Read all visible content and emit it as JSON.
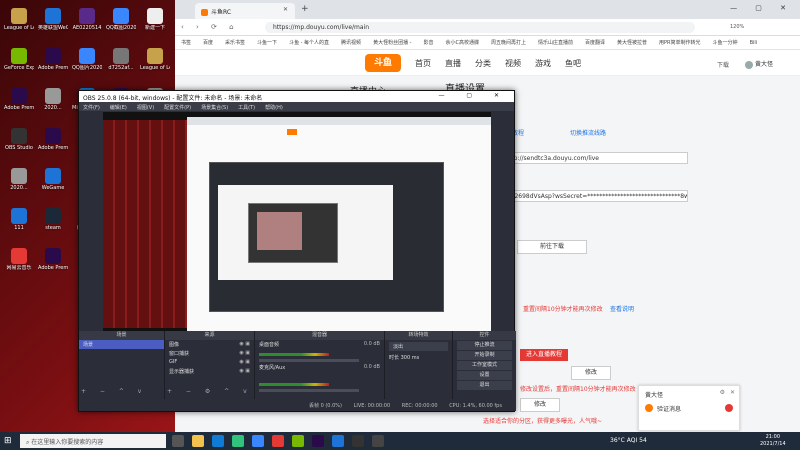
{
  "desktop": {
    "icons": [
      {
        "label": "League of Legends",
        "color": "#c8a24a"
      },
      {
        "label": "英雄联盟WeGame版",
        "color": "#1e73d6"
      },
      {
        "label": "AE0220514",
        "color": "#5a2a8a"
      },
      {
        "label": "QQ截图2020...",
        "color": "#3a86ff"
      },
      {
        "label": "新建一下",
        "color": "#eeeeee"
      },
      {
        "label": "GeForce Experience",
        "color": "#76b900"
      },
      {
        "label": "Adobe Premie...",
        "color": "#2a0a4a"
      },
      {
        "label": "QQ图片2020...",
        "color": "#3a86ff"
      },
      {
        "label": "d7252af...",
        "color": "#777777"
      },
      {
        "label": "League of Legends",
        "color": "#c8a24a"
      },
      {
        "label": "Adobe Premie...",
        "color": "#2a0a4a"
      },
      {
        "label": "2020...",
        "color": "#999999"
      },
      {
        "label": "Microsoft Edge",
        "color": "#0f7bd6"
      },
      {
        "label": "Adobe Premie...",
        "color": "#2a0a4a"
      },
      {
        "label": "2020...",
        "color": "#999999"
      },
      {
        "label": "OBS Studio",
        "color": "#333333"
      },
      {
        "label": "Adobe Premie...",
        "color": "#2a0a4a"
      },
      {
        "label": "2021...",
        "color": "#999999"
      },
      {
        "label": "QQ音乐",
        "color": "#31c27c"
      },
      {
        "label": "logs",
        "color": "#f2c14e"
      },
      {
        "label": "2020...",
        "color": "#999999"
      },
      {
        "label": "WeGame",
        "color": "#1e73d6"
      },
      {
        "label": "视频",
        "color": "#f2c14e"
      },
      {
        "label": "腾讯QQ",
        "color": "#3a86ff"
      },
      {
        "label": "韦行TURE",
        "color": "#f2c14e"
      },
      {
        "label": "111",
        "color": "#1e73d6"
      },
      {
        "label": "steam",
        "color": "#1b2838"
      },
      {
        "label": "腾讯视频",
        "color": "#ff6a00"
      },
      {
        "label": "Adobe Premie...",
        "color": "#2a0a4a"
      },
      {
        "label": "PP 123",
        "color": "#f2c14e"
      },
      {
        "label": "网易云音乐",
        "color": "#e53935"
      },
      {
        "label": "Adobe Premie...",
        "color": "#2a0a4a"
      },
      {
        "label": "微信",
        "color": "#31c27c"
      },
      {
        "label": "Adobe Premie...",
        "color": "#2a0a4a"
      },
      {
        "label": "2021080...",
        "color": "#999999"
      }
    ]
  },
  "browser": {
    "tab_title": "斗鱼RC",
    "url": "https://mp.douyu.com/live/main",
    "zoom": "120%",
    "bookmarks": [
      "书签",
      "百度",
      "采乐书签",
      "斗鱼一下",
      "斗鱼 - 每个人的直",
      "腾讯视频",
      "黄大怪粉丝团播 -",
      "影音",
      "余小C高校通牒",
      "周五晚间再打上",
      "情乐山庄直播前",
      "百度翻译",
      "黄大怪被拉普",
      "用PR简单制作转光",
      "斗鱼一分钟",
      "Bili"
    ],
    "site_logo": "斗鱼",
    "nav": [
      "首页",
      "直播",
      "分类",
      "视频",
      "游戏",
      "鱼吧"
    ],
    "download": "下载",
    "username": "黄大怪"
  },
  "page": {
    "section_title": "直播设置",
    "left_title": "直播中心",
    "link_push_bind": "直播教程",
    "link_switch": "切换推流线路",
    "rtmp_url": "rtmp://sendtc3a.douyu.com/live",
    "stream_key": "8072698dVsAsp?wsSecret=*******************************8wsTime",
    "btn_copy_url": "复制",
    "btn_download": "前往下载",
    "notice_red": "重置间隔10分钟才能再次修改",
    "link_view": "查看说明",
    "btn_reset": "修改",
    "apply_live": "进入直播教程",
    "warn_red": "修改设置后，重置间隔10分钟才能再次修改",
    "btn_modify": "修改",
    "warn_bottom": "选择适合你的分区，获得更多曝光，人气哦~"
  },
  "obs": {
    "title": "OBS 25.0.8 (64-bit, windows) - 配置文件: 未命名 - 场景: 未命名",
    "menu": [
      "文件(F)",
      "编辑(E)",
      "视图(V)",
      "配置文件(P)",
      "场景集合(S)",
      "工具(T)",
      "帮助(H)"
    ],
    "docks": {
      "scenes": {
        "title": "场景",
        "items": [
          "场景"
        ]
      },
      "sources": {
        "title": "来源",
        "items": [
          "图像",
          "窗口捕获",
          "GIF",
          "显示器捕获"
        ]
      },
      "mixer": {
        "title": "混音器",
        "channels": [
          {
            "name": "桌面音频",
            "db": "0.0 dB"
          },
          {
            "name": "麦克风/Aux",
            "db": "0.0 dB"
          }
        ]
      },
      "transitions": {
        "title": "转场特效",
        "type": "淡出",
        "duration_label": "时长",
        "duration": "300 ms"
      },
      "controls": {
        "title": "控件",
        "buttons": [
          "停止推流",
          "开始录制",
          "工作室模式",
          "设置",
          "退出"
        ]
      }
    },
    "status": {
      "drop": "丢帧 0 (0.0%)",
      "live": "LIVE: 00:00:00",
      "rec": "REC: 00:00:00",
      "cpu": "CPU: 1.4%, 60.00 fps"
    }
  },
  "notification": {
    "title": "黄大怪",
    "message": "验证消息"
  },
  "taskbar": {
    "search_placeholder": "在这里输入你要搜索的内容",
    "weather": "36°C  AQI 54",
    "time": "21:00",
    "date": "2021/7/14"
  }
}
